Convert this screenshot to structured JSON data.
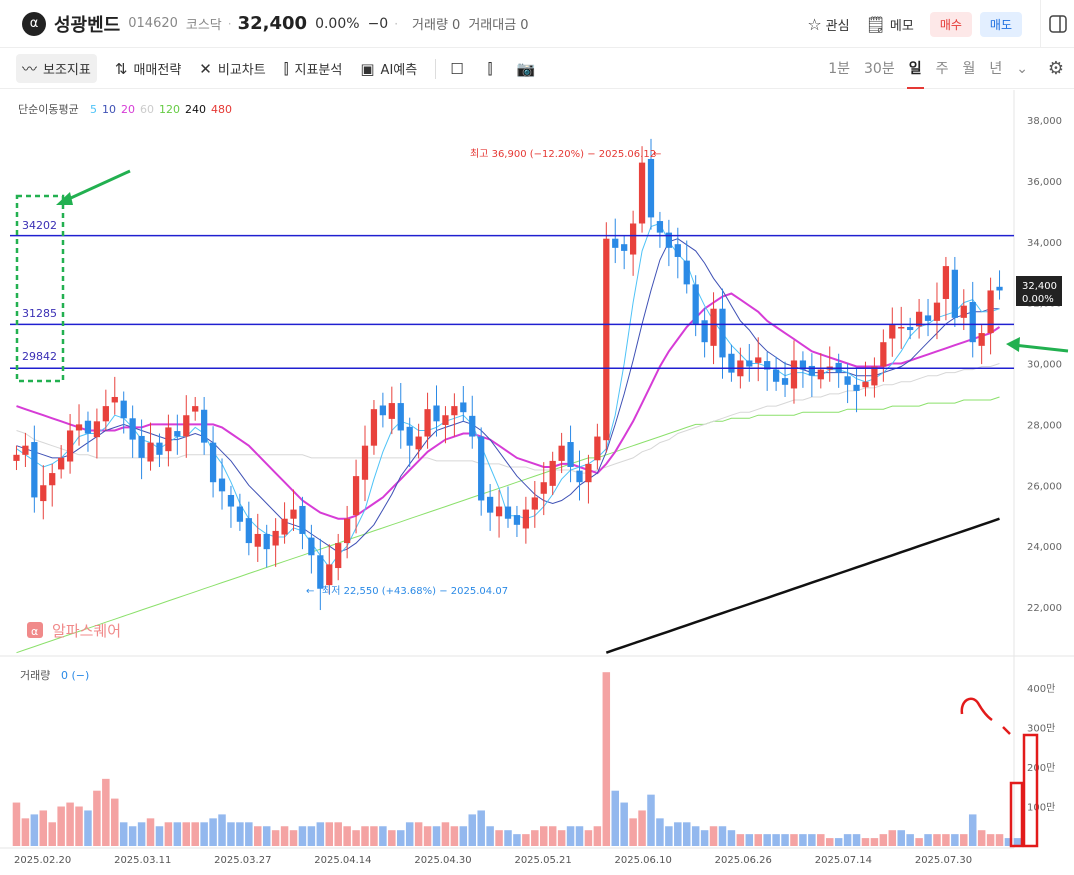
{
  "header": {
    "logo_glyph": "α",
    "name": "성광벤드",
    "code": "014620",
    "market": "코스닥",
    "price": "32,400",
    "change_pct": "0.00%",
    "change_abs": "−0",
    "volume": "거래량 0",
    "amount": "거래대금 0",
    "watch_label": "관심",
    "memo_label": "메모",
    "buy_label": "매수",
    "sell_label": "매도"
  },
  "toolbar": {
    "indicators": "보조지표",
    "strategy": "매매전략",
    "compare": "비교차트",
    "analysis": "지표분석",
    "ai": "AI예측",
    "periods": [
      "1분",
      "30분",
      "일",
      "주",
      "월",
      "년"
    ],
    "selected_period": "일"
  },
  "legend": {
    "title": "단순이동평균",
    "items": [
      {
        "label": "5",
        "color": "#4fc3f7"
      },
      {
        "label": "10",
        "color": "#3f51b5"
      },
      {
        "label": "20",
        "color": "#d63cd6"
      },
      {
        "label": "60",
        "color": "#cccccc"
      },
      {
        "label": "120",
        "color": "#66cc44"
      },
      {
        "label": "240",
        "color": "#111111"
      },
      {
        "label": "480",
        "color": "#e53935"
      }
    ]
  },
  "annotations": {
    "high": "최고 36,900 (−12.20%) − 2025.06.12",
    "low": "최저 22,550 (+43.68%) − 2025.04.07",
    "levels": [
      "34202",
      "31285",
      "29842"
    ],
    "watermark": "알파스퀘어",
    "last_price": "32,400",
    "last_change": "0.00%"
  },
  "volume_panel": {
    "label": "거래량",
    "value": "0 (−)"
  },
  "colors": {
    "up": "#e8413c",
    "down": "#2b8ae6",
    "vol_up": "#f4a3a3",
    "vol_down": "#93b8ee"
  },
  "chart_data": {
    "type": "candlestick",
    "y_ticks": [
      "38,000",
      "36,000",
      "34,000",
      "32,000",
      "30,000",
      "28,000",
      "26,000",
      "24,000",
      "22,000"
    ],
    "volume_ticks": [
      "400만",
      "300만",
      "200만",
      "100만"
    ],
    "x_ticks": [
      "2025.02.20",
      "2025.03.11",
      "2025.03.27",
      "2025.04.14",
      "2025.04.30",
      "2025.05.21",
      "2025.06.10",
      "2025.06.26",
      "2025.07.14",
      "2025.07.30"
    ],
    "ylim": [
      20500,
      38500
    ],
    "support_lines": [
      34202,
      31285,
      29842
    ],
    "close": [
      27000,
      27300,
      25600,
      26000,
      26400,
      26900,
      27800,
      28000,
      27700,
      28100,
      28600,
      28900,
      28200,
      27500,
      26900,
      27400,
      27000,
      27900,
      27600,
      28300,
      28600,
      27400,
      26100,
      25800,
      25300,
      24800,
      24100,
      24400,
      23900,
      24500,
      24900,
      25200,
      24400,
      23700,
      22600,
      23400,
      24100,
      24900,
      26300,
      27300,
      28500,
      28300,
      28700,
      27800,
      27300,
      27600,
      28500,
      28100,
      28300,
      28600,
      28400,
      27600,
      25500,
      25100,
      25300,
      24900,
      24700,
      25200,
      25600,
      26100,
      26800,
      27300,
      26600,
      26100,
      26700,
      27600,
      34100,
      33800,
      33700,
      34600,
      36600,
      34800,
      34300,
      33800,
      33500,
      32600,
      31300,
      30700,
      31800,
      30200,
      29700,
      30100,
      29900,
      30200,
      29800,
      29400,
      29300,
      30100,
      29800,
      29600,
      29800,
      29900,
      29700,
      29300,
      29100,
      29400,
      29900,
      30700,
      31300,
      31200,
      31100,
      31700,
      31400,
      32000,
      33200,
      31500,
      31900,
      30700,
      31000,
      32400,
      32400
    ],
    "volume_m": [
      1.1,
      0.7,
      0.8,
      0.9,
      0.6,
      1.0,
      1.1,
      1.0,
      0.9,
      1.4,
      1.7,
      1.2,
      0.6,
      0.5,
      0.6,
      0.7,
      0.5,
      0.6,
      0.6,
      0.6,
      0.6,
      0.6,
      0.7,
      0.8,
      0.6,
      0.6,
      0.6,
      0.5,
      0.5,
      0.4,
      0.5,
      0.4,
      0.5,
      0.5,
      0.6,
      0.6,
      0.6,
      0.5,
      0.4,
      0.5,
      0.5,
      0.5,
      0.4,
      0.4,
      0.6,
      0.6,
      0.5,
      0.5,
      0.6,
      0.5,
      0.5,
      0.8,
      0.9,
      0.5,
      0.4,
      0.4,
      0.3,
      0.3,
      0.4,
      0.5,
      0.5,
      0.4,
      0.5,
      0.5,
      0.4,
      0.5,
      4.4,
      1.4,
      1.1,
      0.7,
      0.9,
      1.3,
      0.7,
      0.5,
      0.6,
      0.6,
      0.5,
      0.4,
      0.5,
      0.5,
      0.4,
      0.3,
      0.3,
      0.3,
      0.3,
      0.3,
      0.3,
      0.3,
      0.3,
      0.3,
      0.3,
      0.2,
      0.2,
      0.3,
      0.3,
      0.2,
      0.2,
      0.3,
      0.4,
      0.4,
      0.3,
      0.2,
      0.3,
      0.3,
      0.3,
      0.3,
      0.3,
      0.8,
      0.4,
      0.3,
      0.3,
      0.2,
      0.2
    ],
    "ma5": [
      27200,
      27000,
      26800,
      26600,
      26700,
      26900,
      27200,
      27600,
      27700,
      27700,
      27900,
      28300,
      28200,
      27900,
      27500,
      27400,
      27200,
      27400,
      27600,
      27600,
      27900,
      27700,
      27100,
      26700,
      26100,
      25400,
      24900,
      24600,
      24400,
      24300,
      24300,
      24600,
      24500,
      24100,
      23700,
      23300,
      23700,
      24000,
      24600,
      25200,
      26200,
      27100,
      27800,
      28100,
      28000,
      27800,
      27800,
      27900,
      28100,
      28200,
      28300,
      28000,
      27300,
      26600,
      25900,
      25000,
      25000,
      24900,
      25000,
      25300,
      25700,
      26200,
      26500,
      26600,
      26700,
      26900,
      27200,
      28300,
      30000,
      32000,
      33700,
      34500,
      34600,
      34000,
      33600,
      33300,
      32500,
      31900,
      31400,
      31000,
      30600,
      30300,
      30000,
      30000,
      29900,
      29800,
      29600,
      29700,
      29700,
      29600,
      29600,
      29800,
      29800,
      29700,
      29500,
      29400,
      29500,
      29700,
      30000,
      30400,
      30900,
      31200,
      31300,
      31500,
      31600,
      31700,
      32000,
      32100,
      31700,
      31700,
      31800
    ],
    "ma10": [
      27300,
      27200,
      27100,
      27000,
      26900,
      26900,
      27000,
      27200,
      27400,
      27600,
      27800,
      27900,
      28000,
      27900,
      27800,
      27700,
      27600,
      27500,
      27500,
      27600,
      27700,
      27600,
      27400,
      27100,
      26800,
      26400,
      26000,
      25700,
      25400,
      25100,
      24800,
      24700,
      24600,
      24400,
      24200,
      24000,
      23800,
      23900,
      24100,
      24400,
      24700,
      25200,
      25700,
      26300,
      26700,
      27100,
      27500,
      27800,
      27900,
      28000,
      28100,
      28000,
      27800,
      27500,
      27100,
      26700,
      26300,
      26000,
      25700,
      25500,
      25400,
      25500,
      25700,
      26000,
      26200,
      26400,
      27100,
      28000,
      29000,
      30100,
      31300,
      32400,
      33400,
      34000,
      34100,
      33900,
      33700,
      33300,
      32800,
      32400,
      31900,
      31400,
      31100,
      30700,
      30400,
      30200,
      30000,
      29900,
      29800,
      29700,
      29700,
      29700,
      29700,
      29700,
      29600,
      29600,
      29600,
      29700,
      29800,
      29900,
      30100,
      30400,
      30700,
      31000,
      31300,
      31500,
      31600,
      31700,
      31700,
      31800,
      31800
    ],
    "ma20": [
      28600,
      28500,
      28400,
      28300,
      28200,
      28100,
      28000,
      27900,
      27800,
      27800,
      27800,
      27800,
      27900,
      27900,
      27900,
      28000,
      28000,
      28000,
      28000,
      28000,
      28000,
      28000,
      28000,
      27900,
      27700,
      27500,
      27300,
      27000,
      26700,
      26400,
      26100,
      25800,
      25500,
      25300,
      25100,
      25000,
      24900,
      24900,
      25000,
      25200,
      25400,
      25600,
      25900,
      26200,
      26500,
      26800,
      27100,
      27300,
      27500,
      27600,
      27700,
      27700,
      27600,
      27500,
      27300,
      27100,
      26900,
      26800,
      26700,
      26600,
      26600,
      26700,
      26700,
      26600,
      26500,
      26400,
      26700,
      27100,
      27600,
      28100,
      28700,
      29300,
      29900,
      30400,
      30800,
      31200,
      31500,
      31800,
      32000,
      32200,
      32300,
      32100,
      31900,
      31700,
      31400,
      31200,
      31000,
      30800,
      30600,
      30400,
      30300,
      30200,
      30100,
      30000,
      29900,
      29900,
      29900,
      29900,
      30000,
      30000,
      30100,
      30200,
      30300,
      30400,
      30500,
      30600,
      30700,
      30800,
      30900,
      31000,
      31200
    ],
    "ma60": [
      27800,
      27700,
      27500,
      27400,
      27300,
      27200,
      27100,
      27000,
      27000,
      26900,
      26900,
      26900,
      26900,
      26900,
      26900,
      26900,
      26900,
      26900,
      26900,
      27000,
      27000,
      27000,
      27000,
      27000,
      27000,
      27000,
      27000,
      27000,
      27000,
      27000,
      27000,
      27000,
      27000,
      26900,
      26900,
      26900,
      26900,
      26900,
      26900,
      26900,
      26900,
      26900,
      26900,
      26900,
      26900,
      26900,
      26900,
      26800,
      26800,
      26800,
      26800,
      26800,
      26700,
      26700,
      26700,
      26600,
      26600,
      26600,
      26500,
      26500,
      26500,
      26500,
      26500,
      26400,
      26400,
      26500,
      26600,
      26700,
      26800,
      26900,
      27100,
      27200,
      27400,
      27500,
      27700,
      27800,
      27900,
      28000,
      28100,
      28200,
      28300,
      28400,
      28400,
      28500,
      28600,
      28600,
      28700,
      28800,
      28800,
      28900,
      28900,
      29000,
      29000,
      29100,
      29100,
      29200,
      29200,
      29300,
      29300,
      29400,
      29400,
      29500,
      29600,
      29600,
      29700,
      29700,
      29800,
      29800,
      29900,
      29900,
      30000
    ],
    "ma120": [
      20500,
      20600,
      20700,
      20800,
      20900,
      21000,
      21100,
      21200,
      21300,
      21400,
      21500,
      21600,
      21700,
      21800,
      21900,
      22000,
      22100,
      22200,
      22300,
      22400,
      22500,
      22600,
      22700,
      22800,
      22900,
      23000,
      23100,
      23200,
      23300,
      23400,
      23500,
      23600,
      23700,
      23800,
      23900,
      24000,
      24100,
      24200,
      24300,
      24400,
      24500,
      24600,
      24700,
      24800,
      24900,
      25000,
      25100,
      25200,
      25300,
      25400,
      25500,
      25600,
      25700,
      25800,
      25900,
      26000,
      26100,
      26200,
      26300,
      26400,
      26500,
      26600,
      26700,
      26800,
      26900,
      26900,
      27000,
      27100,
      27200,
      27300,
      27400,
      27500,
      27600,
      27700,
      27800,
      27900,
      28000,
      28000,
      28100,
      28100,
      28200,
      28200,
      28200,
      28300,
      28300,
      28300,
      28300,
      28300,
      28400,
      28400,
      28400,
      28400,
      28400,
      28500,
      28500,
      28500,
      28500,
      28500,
      28600,
      28600,
      28600,
      28600,
      28700,
      28700,
      28700,
      28700,
      28800,
      28800,
      28800,
      28800,
      28900
    ],
    "ma240_note": "black line lower right",
    "ma240": [
      null,
      null,
      null,
      null,
      null,
      null,
      null,
      null,
      null,
      null,
      null,
      null,
      null,
      null,
      null,
      null,
      null,
      null,
      null,
      null,
      null,
      null,
      null,
      null,
      null,
      null,
      null,
      null,
      null,
      null,
      null,
      null,
      null,
      null,
      null,
      null,
      null,
      null,
      null,
      null,
      null,
      null,
      null,
      null,
      null,
      null,
      null,
      null,
      null,
      null,
      null,
      null,
      null,
      null,
      null,
      null,
      null,
      null,
      null,
      null,
      null,
      null,
      null,
      null,
      null,
      null,
      20500,
      20600,
      20700,
      20800,
      20900,
      21000,
      21100,
      21200,
      21300,
      21400,
      21500,
      21600,
      21700,
      21800,
      21900,
      22000,
      22100,
      22200,
      22300,
      22400,
      22500,
      22600,
      22700,
      22800,
      22900,
      23000,
      23100,
      23200,
      23300,
      23400,
      23500,
      23600,
      23700,
      23800,
      23900,
      24000,
      24100,
      24200,
      24300,
      24400,
      24500,
      24600,
      24700,
      24800,
      24900
    ]
  }
}
